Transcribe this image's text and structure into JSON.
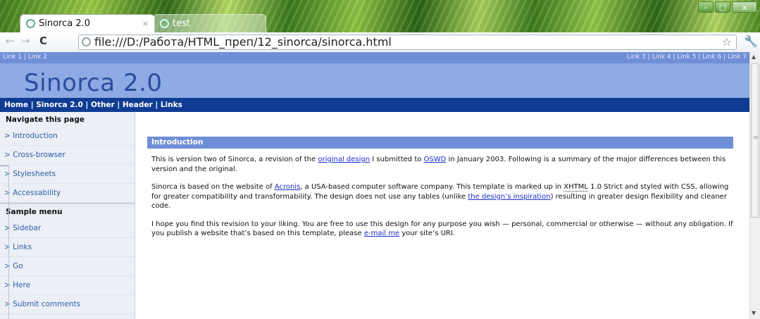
{
  "browser": {
    "tabs": [
      {
        "label": "Sinorca 2.0",
        "close": "×"
      },
      {
        "label": "test"
      }
    ],
    "window_controls": {
      "minimize": "–",
      "maximize": "□",
      "close": "x"
    },
    "nav": {
      "back": "←",
      "forward": "→",
      "reload": "C"
    },
    "address": "file:///D:/Работа/HTML_преп/12_sinorca/sinorca.html",
    "star": "☆",
    "wrench": "🔧"
  },
  "page": {
    "topbar": {
      "left": [
        "Link 1",
        "Link 2"
      ],
      "right": [
        "Link 3",
        "Link 4",
        "Link 5",
        "Link 6",
        "Link 7"
      ]
    },
    "title": "Sinorca 2.0",
    "navbar": [
      "Home",
      "Sinorca 2.0",
      "Other",
      "Header",
      "Links"
    ],
    "sidebar": {
      "nav_heading": "Navigate this page",
      "nav_items": [
        "> Introduction",
        "> Cross-browser",
        "> Stylesheets",
        "> Accessability"
      ],
      "menu_heading": "Sample menu",
      "menu_items": [
        "> Sidebar",
        "> Links",
        "> Go",
        "> Here",
        "> Submit comments"
      ]
    },
    "section": {
      "heading": "Introduction",
      "p1": {
        "t1": "This is version two of Sinorca, a revision of the ",
        "link1": "original design",
        "t2": " I submitted to ",
        "link2": "OSWD",
        "t3": " in January 2003. Following is a summary of the major differences between this version and the original."
      },
      "p2": {
        "t1": "Sinorca is based on the website of ",
        "link1": "Acronis",
        "t2": ", a USA-based computer software company. This template is marked up in ",
        "abbr": "XHTML",
        "t3": " 1.0 Strict and styled with CSS, allowing for greater compatibility and transformability. The design does not use any tables (unlike ",
        "link2": "the design’s inspiration",
        "t4": ") resulting in greater design flexibility and cleaner code."
      },
      "p3": {
        "t1": "I hope you find this revision to your liking. You are free to use this design for any purpose you wish — personal, commercial or otherwise — without any obligation. If you publish a website that’s based on this template, please ",
        "link1": "e-mail me",
        "t2": " your site’s URI."
      }
    }
  },
  "scrollbar": {
    "up": "▲",
    "down": "▼",
    "grip": "≡"
  },
  "colors": {
    "topbar": "#6f8fd6",
    "header": "#8eaae4",
    "navbar": "#0f3c93",
    "title": "#2a4d9c",
    "link": "#1a2fd0"
  }
}
